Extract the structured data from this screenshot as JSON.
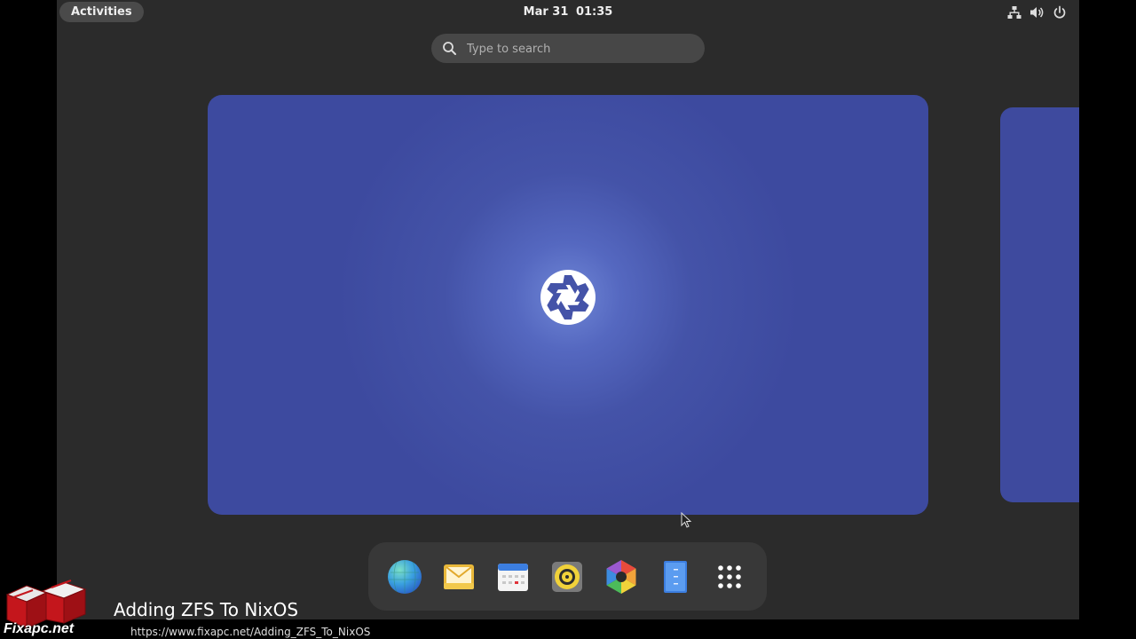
{
  "topbar": {
    "activities_label": "Activities",
    "date": "Mar 31",
    "time": "01:35",
    "status_icons": [
      "network-icon",
      "volume-icon",
      "power-icon"
    ]
  },
  "search": {
    "placeholder": "Type to search"
  },
  "workspaces": {
    "current_background": "#3d4a9f",
    "logo": "nixos-snowflake-icon"
  },
  "dock": {
    "items": [
      "web-browser-icon",
      "mail-icon",
      "calendar-icon",
      "music-icon",
      "photos-icon",
      "files-icon",
      "app-grid-icon"
    ]
  },
  "overlay": {
    "title": "Adding ZFS To NixOS",
    "url": "https://www.fixapc.net/Adding_ZFS_To_NixOS",
    "logo_text": "Fixapc.net"
  },
  "colors": {
    "panel": "#2b2b2b",
    "dock": "#383838",
    "workspace": "#3d4a9f"
  }
}
